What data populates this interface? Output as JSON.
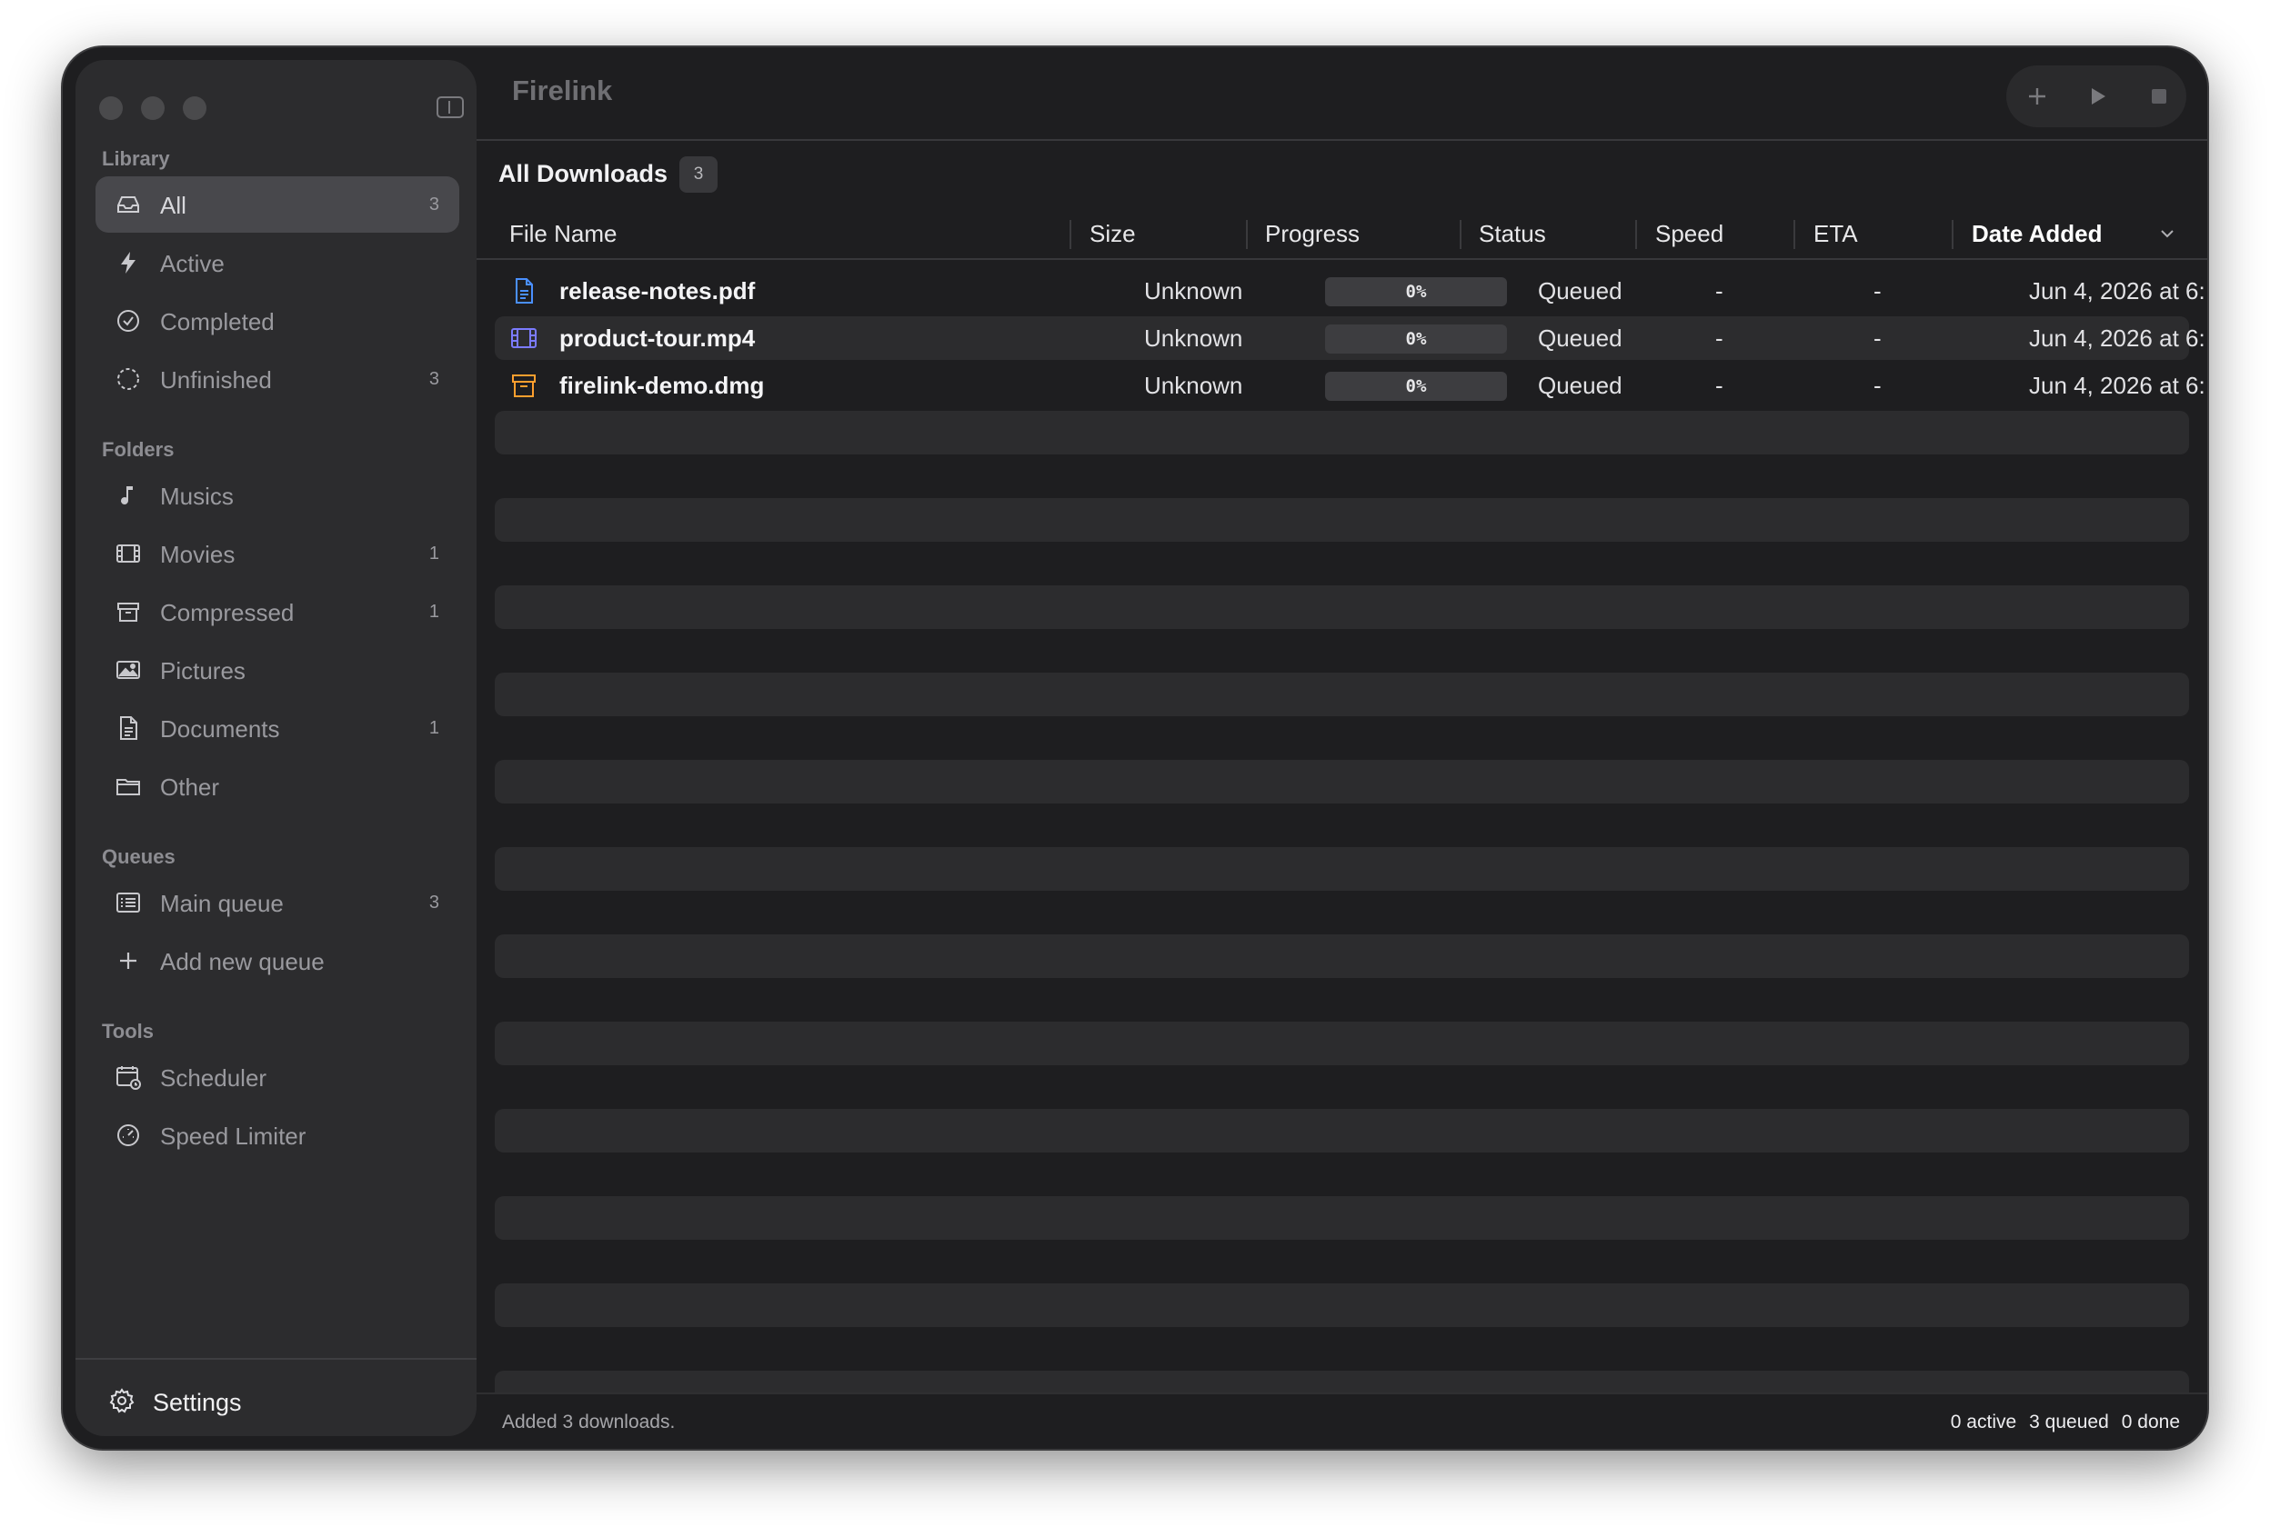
{
  "app": {
    "title": "Firelink"
  },
  "sidebar": {
    "sections": {
      "library": "Library",
      "folders": "Folders",
      "queues": "Queues",
      "tools": "Tools"
    },
    "library": [
      {
        "label": "All",
        "count": "3",
        "icon": "tray-icon",
        "selected": true
      },
      {
        "label": "Active",
        "count": "",
        "icon": "bolt-icon"
      },
      {
        "label": "Completed",
        "count": "",
        "icon": "check-circle-icon"
      },
      {
        "label": "Unfinished",
        "count": "3",
        "icon": "dashed-circle-icon"
      }
    ],
    "folders": [
      {
        "label": "Musics",
        "count": "",
        "icon": "music-note-icon"
      },
      {
        "label": "Movies",
        "count": "1",
        "icon": "film-icon"
      },
      {
        "label": "Compressed",
        "count": "1",
        "icon": "archive-box-icon"
      },
      {
        "label": "Pictures",
        "count": "",
        "icon": "photo-icon"
      },
      {
        "label": "Documents",
        "count": "1",
        "icon": "document-icon"
      },
      {
        "label": "Other",
        "count": "",
        "icon": "folder-icon"
      }
    ],
    "queues": [
      {
        "label": "Main queue",
        "count": "3",
        "icon": "list-icon"
      },
      {
        "label": "Add new queue",
        "count": "",
        "icon": "plus-icon"
      }
    ],
    "tools": [
      {
        "label": "Scheduler",
        "count": "",
        "icon": "calendar-clock-icon"
      },
      {
        "label": "Speed Limiter",
        "count": "",
        "icon": "gauge-icon"
      }
    ],
    "settings_label": "Settings"
  },
  "toolbar": {
    "add": "plus-icon",
    "start": "play-icon",
    "stop": "stop-icon"
  },
  "main": {
    "heading": "All Downloads",
    "heading_count": "3",
    "columns": [
      "File Name",
      "Size",
      "Progress",
      "Status",
      "Speed",
      "ETA",
      "Date Added"
    ],
    "sorted_column": "Date Added",
    "rows": [
      {
        "name": "release-notes.pdf",
        "icon": "document-icon",
        "icon_color": "#4a90ff",
        "size": "Unknown",
        "progress": 0,
        "progress_text": "0%",
        "status": "Queued",
        "speed": "-",
        "eta": "-",
        "date": "Jun 4, 2026 at 6:..."
      },
      {
        "name": "product-tour.mp4",
        "icon": "film-icon",
        "icon_color": "#7b7bff",
        "size": "Unknown",
        "progress": 0,
        "progress_text": "0%",
        "status": "Queued",
        "speed": "-",
        "eta": "-",
        "date": "Jun 4, 2026 at 6:..."
      },
      {
        "name": "firelink-demo.dmg",
        "icon": "archive-box-icon",
        "icon_color": "#ff9f2e",
        "size": "Unknown",
        "progress": 0,
        "progress_text": "0%",
        "status": "Queued",
        "speed": "-",
        "eta": "-",
        "date": "Jun 4, 2026 at 6:..."
      }
    ]
  },
  "statusbar": {
    "message": "Added 3 downloads.",
    "active": "0 active",
    "queued": "3 queued",
    "done": "0 done"
  }
}
